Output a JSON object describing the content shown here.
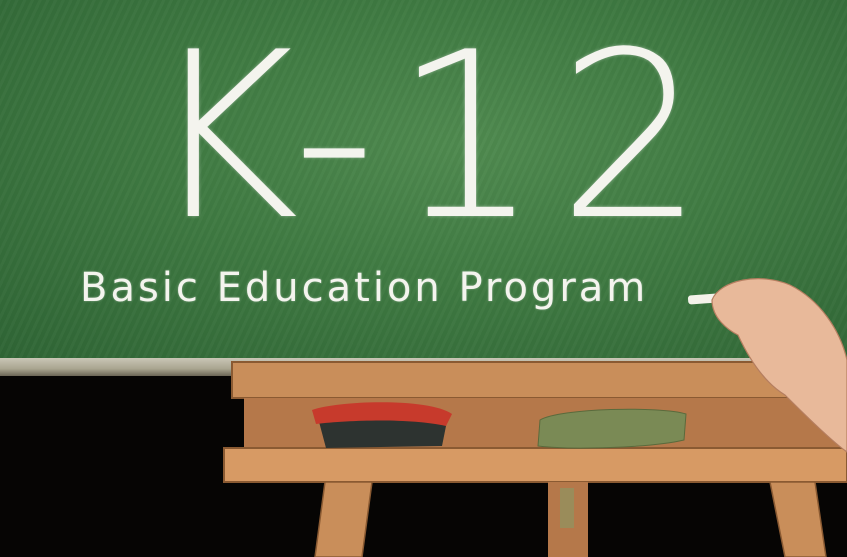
{
  "board": {
    "title": "K-12",
    "subtitle": "Basic Education Program"
  },
  "colors": {
    "chalkboard": "#3f7a42",
    "chalk": "#f4f4ee",
    "easel_wood": "#c98e5a",
    "red_eraser": "#c73a2c",
    "green_sponge": "#7a8a55"
  }
}
